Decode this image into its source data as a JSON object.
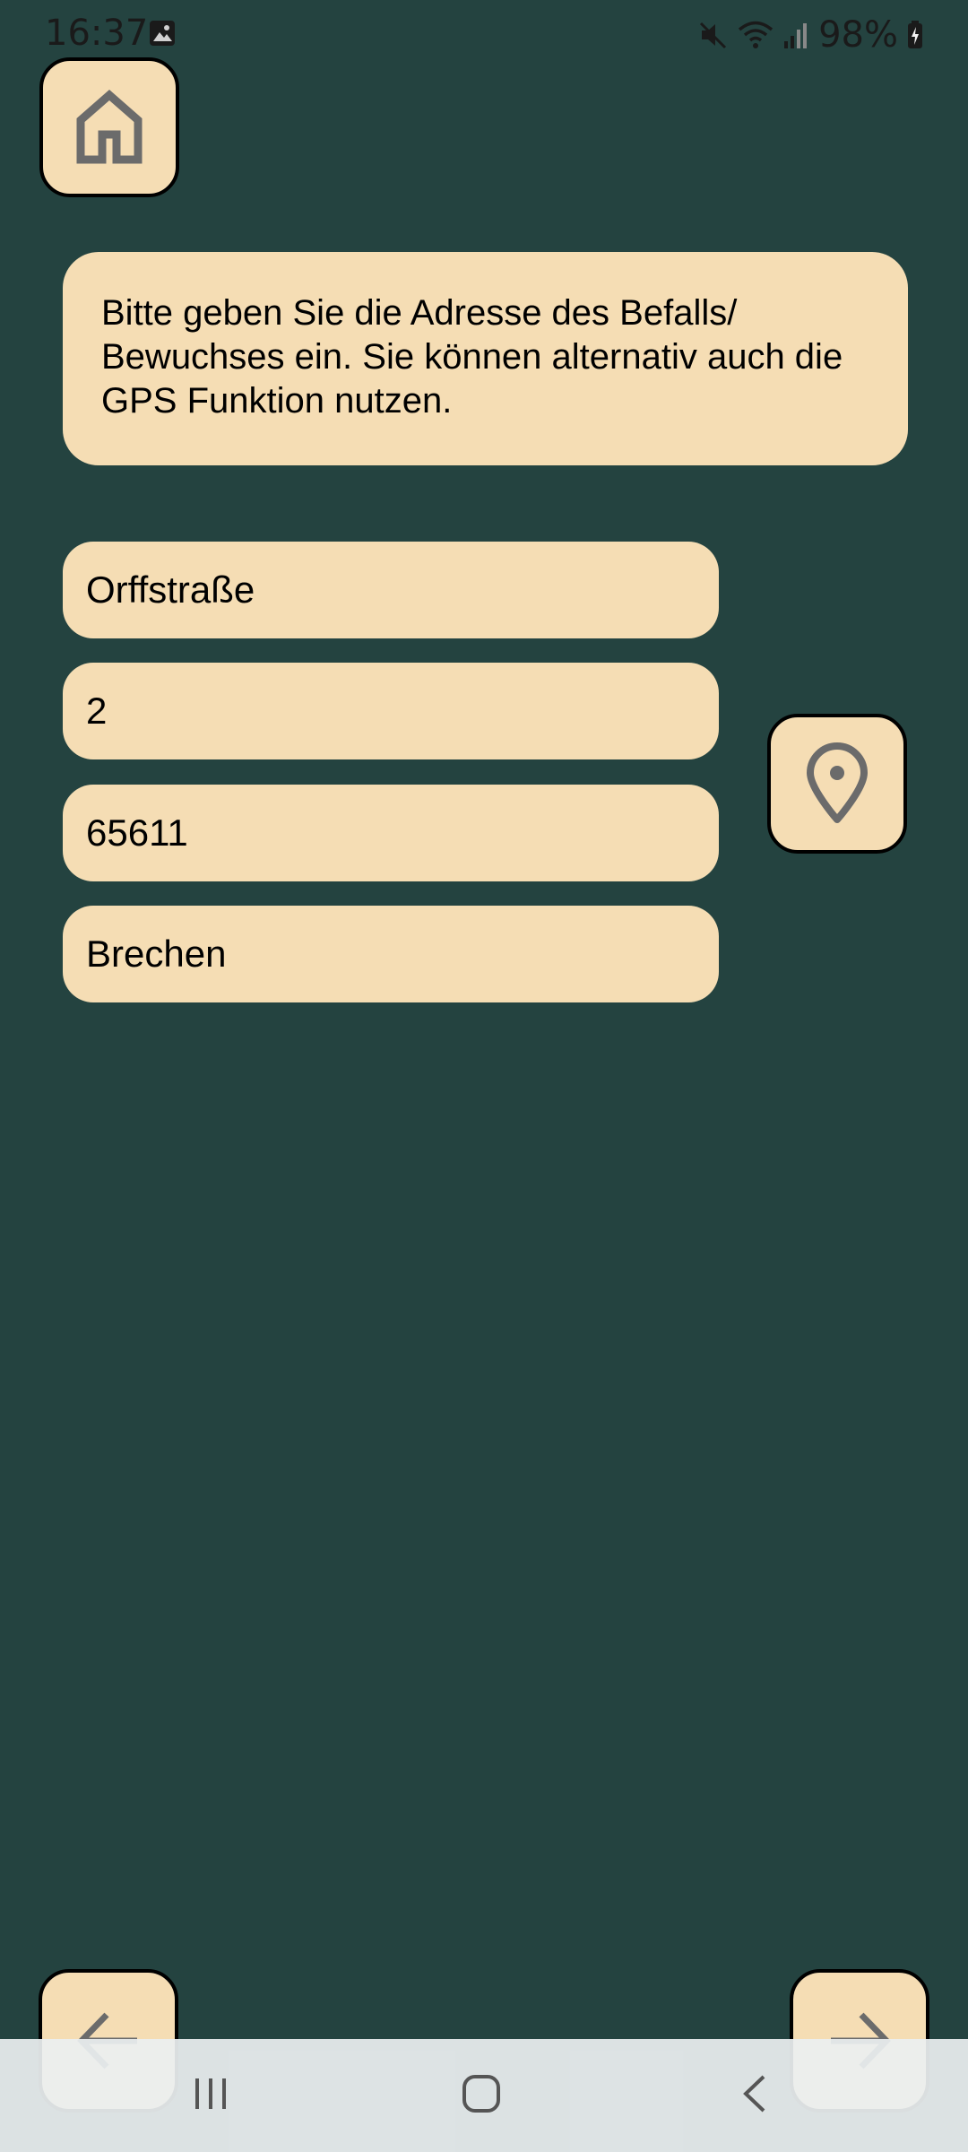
{
  "status_bar": {
    "time": "16:37",
    "battery": "98%",
    "icons": [
      "image-icon",
      "mute-icon",
      "wifi-icon",
      "signal-icon",
      "battery-charging-icon"
    ]
  },
  "home_button": {
    "icon": "home-icon"
  },
  "info_text": "Bitte geben Sie die Adresse des Befalls/ Bewuchses ein. Sie können alternativ auch die GPS Funktion nutzen.",
  "address": {
    "street": "Orffstraße",
    "house_number": "2",
    "postal_code": "65611",
    "city": "Brechen"
  },
  "gps_button": {
    "icon": "location-pin-icon"
  },
  "navigation": {
    "prev_icon": "arrow-left-icon",
    "next_icon": "arrow-right-icon"
  },
  "system_nav": {
    "icons": [
      "recent-apps-icon",
      "home-circle-icon",
      "back-icon"
    ]
  },
  "colors": {
    "background": "#244340",
    "accent": "#f5ddb4",
    "icon_grey": "#6b6b6b"
  }
}
